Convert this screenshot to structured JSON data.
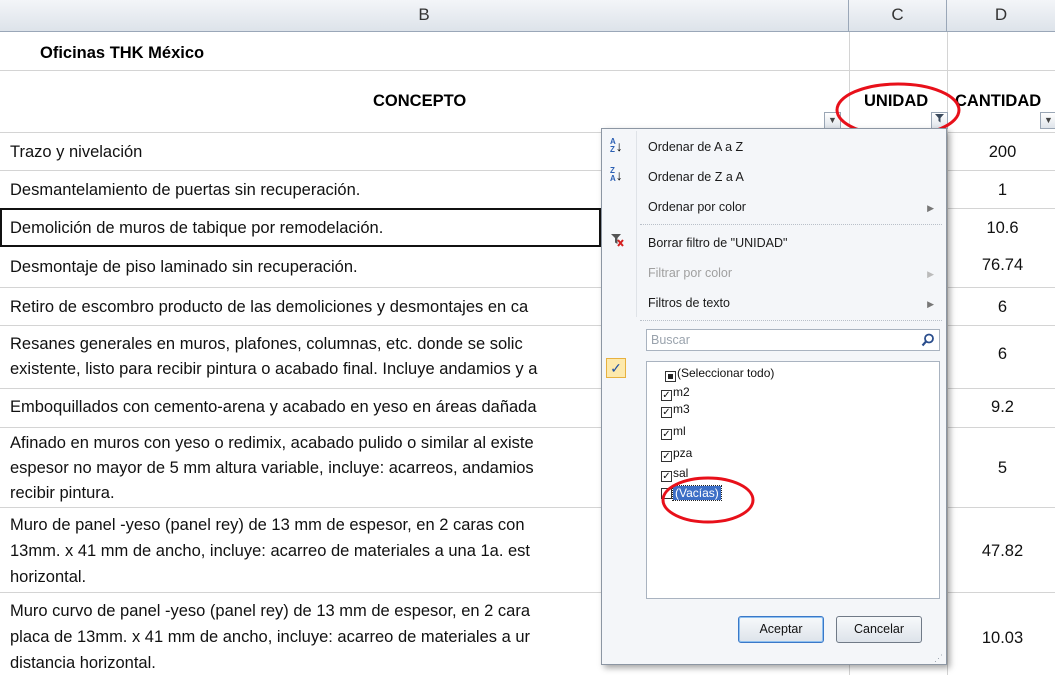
{
  "columns": [
    "B",
    "C",
    "D"
  ],
  "company": "Oficinas THK México",
  "headers": {
    "concepto": "CONCEPTO",
    "unidad": "UNIDAD",
    "cantidad": "CANTIDAD"
  },
  "rows": [
    {
      "lines": [
        "Trazo y nivelación"
      ],
      "qty": "200"
    },
    {
      "lines": [
        "Desmantelamiento de puertas sin recuperación."
      ],
      "qty": "1"
    },
    {
      "lines": [
        "Demolición de muros de tabique por remodelación."
      ],
      "qty": "10.6"
    },
    {
      "lines": [
        "Desmontaje de piso laminado sin recuperación."
      ],
      "qty": "76.74"
    },
    {
      "lines": [
        "Retiro de escombro producto de las demoliciones y desmontajes en ca"
      ],
      "qty": "6"
    },
    {
      "lines": [
        "Resanes generales en  muros, plafones, columnas, etc. donde se solic",
        "existente, listo para recibir pintura o acabado final. Incluye andamios y a"
      ],
      "qty": "6"
    },
    {
      "lines": [
        "Emboquillados con cemento-arena y acabado en yeso en áreas dañada"
      ],
      "qty": "9.2"
    },
    {
      "lines": [
        "Afinado en muros con yeso o redimix, acabado pulido o similar al existe",
        "espesor no mayor de 5 mm altura variable, incluye: acarreos, andamios",
        "recibir pintura."
      ],
      "qty": "5"
    },
    {
      "lines": [
        "Muro de panel -yeso (panel rey) de 13 mm de espesor, en 2 caras con",
        "13mm. x 41 mm de ancho, incluye: acarreo de materiales a una 1a. est",
        "horizontal."
      ],
      "qty": "47.82"
    },
    {
      "lines": [
        "Muro curvo de panel -yeso (panel rey) de 13 mm de espesor, en 2 cara",
        "placa de 13mm. x 41 mm de ancho, incluye: acarreo de materiales a ur",
        "distancia horizontal."
      ],
      "qty": "10.03"
    }
  ],
  "filter_menu": {
    "sort_az": "Ordenar de A a Z",
    "sort_za": "Ordenar de Z a A",
    "sort_color": "Ordenar por color",
    "clear_filter": "Borrar filtro de \"UNIDAD\"",
    "filter_color": "Filtrar por color",
    "text_filters": "Filtros de texto",
    "search_placeholder": "Buscar",
    "items": [
      {
        "label": "(Seleccionar todo)",
        "state": "partial"
      },
      {
        "label": "m2",
        "state": "checked"
      },
      {
        "label": "m3",
        "state": "checked"
      },
      {
        "label": "ml",
        "state": "checked"
      },
      {
        "label": "pza",
        "state": "checked"
      },
      {
        "label": "sal",
        "state": "checked"
      },
      {
        "label": "(Vacías)",
        "state": "unchecked"
      }
    ],
    "ok": "Aceptar",
    "cancel": "Cancelar"
  },
  "colors": {
    "highlight_circle": "#e8101a",
    "selection": "#3d6fc6"
  }
}
